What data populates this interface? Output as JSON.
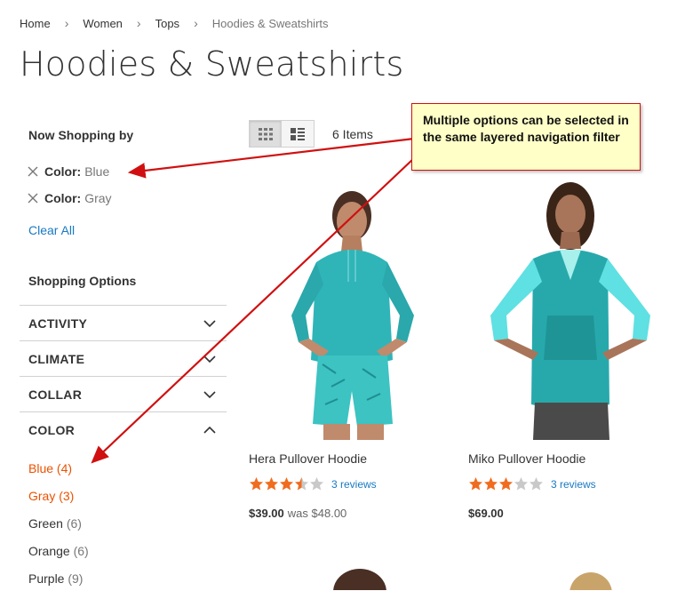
{
  "breadcrumbs": [
    "Home",
    "Women",
    "Tops",
    "Hoodies & Sweatshirts"
  ],
  "page_title": "Hoodies & Sweatshirts",
  "filters": {
    "title": "Now Shopping by",
    "active": [
      {
        "label": "Color:",
        "value": "Blue"
      },
      {
        "label": "Color:",
        "value": "Gray"
      }
    ],
    "clear_all": "Clear All"
  },
  "shopping_options": {
    "title": "Shopping Options",
    "sections": [
      "ACTIVITY",
      "CLIMATE",
      "COLLAR",
      "COLOR"
    ],
    "expanded": "COLOR",
    "color_options": [
      {
        "name": "Blue",
        "count": "(4)",
        "selected": true
      },
      {
        "name": "Gray",
        "count": "(3)",
        "selected": true
      },
      {
        "name": "Green",
        "count": "(6)",
        "selected": false
      },
      {
        "name": "Orange",
        "count": "(6)",
        "selected": false
      },
      {
        "name": "Purple",
        "count": "(9)",
        "selected": false
      }
    ]
  },
  "toolbar": {
    "view_modes": [
      "grid",
      "list"
    ],
    "active_mode": "grid",
    "items_count": "6 Items"
  },
  "products": [
    {
      "name": "Hera Pullover Hoodie",
      "rating": 3.5,
      "reviews": "3 reviews",
      "price": "$39.00",
      "was_label": "was",
      "old_price": "$48.00"
    },
    {
      "name": "Miko Pullover Hoodie",
      "rating": 3,
      "reviews": "3 reviews",
      "price": "$69.00",
      "was_label": "",
      "old_price": ""
    }
  ],
  "callout": {
    "text": "Multiple options can be selected in the same layered navigation filter"
  },
  "colors": {
    "accent_link": "#1979c3",
    "selected_filter": "#eb5202",
    "star": "#f06c1f",
    "star_empty": "#c9c9c9",
    "callout_bg": "#ffffc8",
    "arrow": "#d01010",
    "product_top": "#2fb5b8"
  }
}
